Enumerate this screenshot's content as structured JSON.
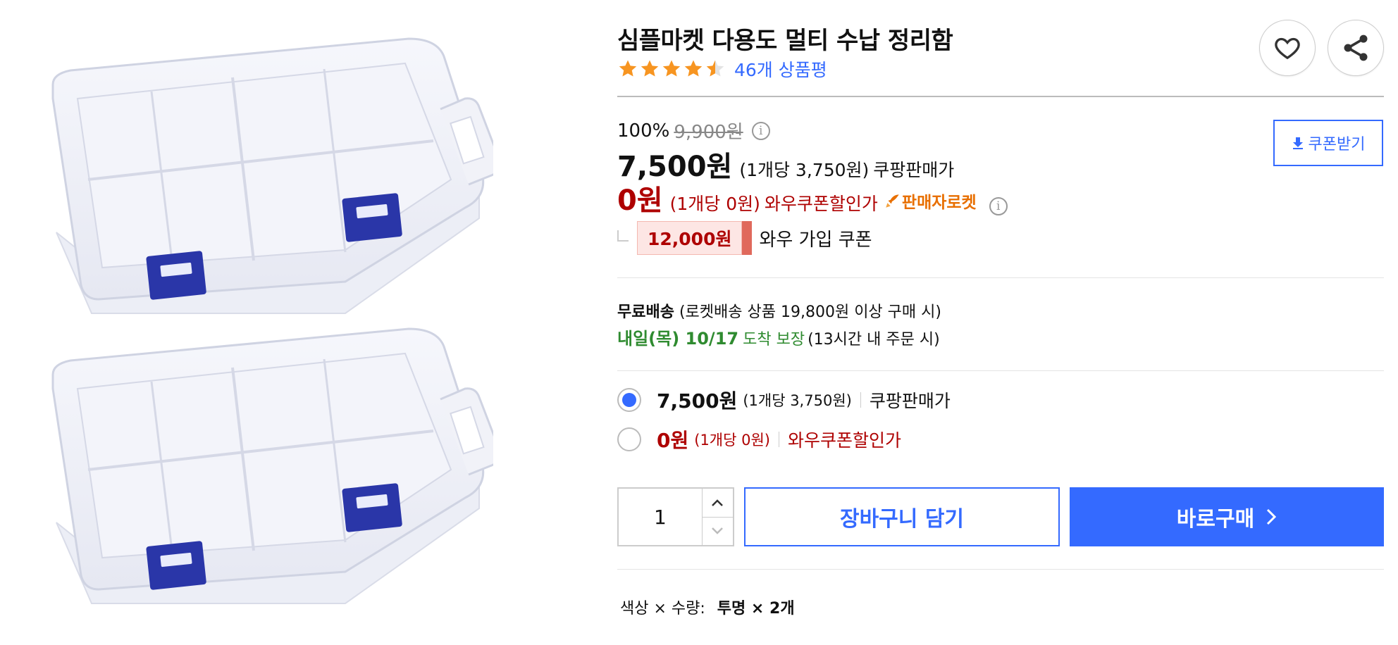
{
  "product": {
    "title": "심플마켓 다용도 멀티 수납 정리함",
    "rating_stars": 4.5,
    "review_count_label": "46개 상품평"
  },
  "actions": {
    "wishlist_icon": "heart-icon",
    "share_icon": "share-icon"
  },
  "pricing": {
    "discount_rate": "100%",
    "original_price": "9,900원",
    "sale_price": "7,500원",
    "sale_unit_price": "(1개당 3,750원)",
    "sale_label": "쿠팡판매가",
    "wow_price": "0원",
    "wow_unit_price": "(1개당 0원)",
    "wow_label": "와우쿠폰할인가",
    "seller_badge": "판매자로켓",
    "coupon_button_label": "쿠폰받기",
    "join_coupon_amount": "12,000원",
    "join_coupon_label": "와우 가입 쿠폰"
  },
  "shipping": {
    "free_label": "무료배송",
    "free_condition": "(로켓배송 상품 19,800원 이상 구매 시)",
    "arrival_date": "내일(목) 10/17",
    "arrival_guarantee": "도착 보장",
    "arrival_condition": "(13시간 내 주문 시)"
  },
  "options": [
    {
      "price": "7,500원",
      "unit": "(1개당 3,750원)",
      "label": "쿠팡판매가",
      "selected": true
    },
    {
      "price": "0원",
      "unit": "(1개당 0원)",
      "label": "와우쿠폰할인가",
      "selected": false
    }
  ],
  "purchase": {
    "quantity": "1",
    "cart_label": "장바구니 담기",
    "buy_label": "바로구매"
  },
  "variant": {
    "label": "색상 × 수량:",
    "value": "투명 × 2개"
  },
  "colors": {
    "accent_blue": "#346aff",
    "wow_red": "#ae0000",
    "delivery_green": "#2f8b30",
    "star_orange": "#f79521",
    "clasp_blue": "#2a36a8"
  }
}
